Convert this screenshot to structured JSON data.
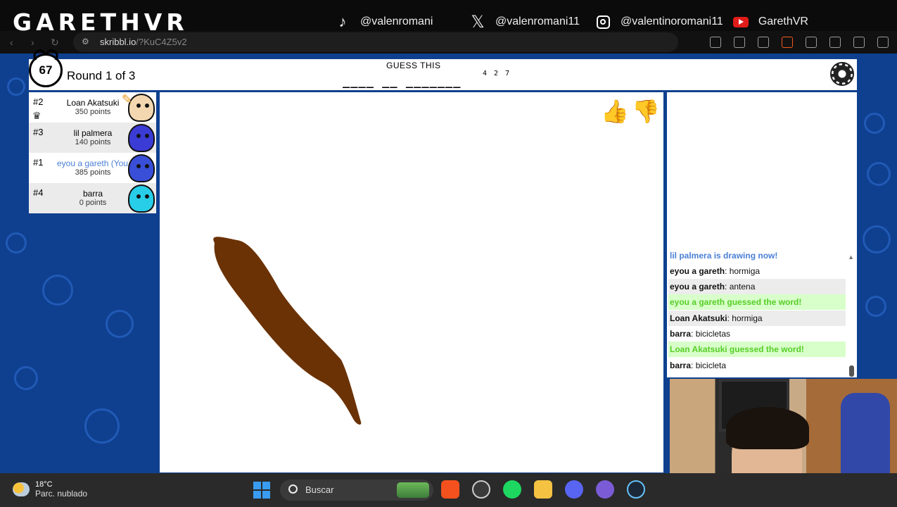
{
  "overlay": {
    "brand": "GARETHVR",
    "socials": [
      {
        "icon": "tiktok-icon",
        "handle": "@valenromani"
      },
      {
        "icon": "x-icon",
        "handle": "@valenromani11"
      },
      {
        "icon": "instagram-icon",
        "handle": "@valentinoromani11"
      },
      {
        "icon": "youtube-icon",
        "handle": "GarethVR"
      }
    ]
  },
  "browser": {
    "url_host": "skribbl.io",
    "url_path": "/?KuC4Z5v2"
  },
  "game": {
    "timer": "67",
    "round_text": "Round 1 of 3",
    "guess_label": "GUESS THIS",
    "hint": "____ __ _______",
    "hint_lengths": "4 2 7"
  },
  "players": [
    {
      "rank": "#2",
      "name": "Loan Akatsuki",
      "points": "350 points",
      "avatar_color": "#f3d7b1",
      "drawing": true
    },
    {
      "rank": "#3",
      "name": "lil palmera",
      "points": "140 points",
      "avatar_color": "#3b3bd6"
    },
    {
      "rank": "#1",
      "name": "eyou a gareth (You)",
      "points": "385 points",
      "avatar_color": "#3a4fd8",
      "you": true
    },
    {
      "rank": "#4",
      "name": "barra",
      "points": "0 points",
      "avatar_color": "#28cde8"
    }
  ],
  "chat": [
    {
      "type": "sys",
      "text": "lil palmera is drawing now!"
    },
    {
      "type": "msg",
      "user": "eyou a gareth",
      "text": "hormiga"
    },
    {
      "type": "msg",
      "user": "eyou a gareth",
      "text": "antena"
    },
    {
      "type": "ok",
      "text": "eyou a gareth guessed the word!"
    },
    {
      "type": "msg",
      "user": "Loan Akatsuki",
      "text": "hormiga"
    },
    {
      "type": "msg",
      "user": "barra",
      "text": "bicicletas"
    },
    {
      "type": "ok",
      "text": "Loan Akatsuki guessed the word!"
    },
    {
      "type": "msg",
      "user": "barra",
      "text": "bicicleta"
    }
  ],
  "taskbar": {
    "temp": "18°C",
    "weather": "Parc. nublado",
    "search_placeholder": "Buscar"
  },
  "colors": {
    "accent_you": "#4a7fd6",
    "guess_ok": "#56ce27",
    "drawing_brown": "#6b3206",
    "background": "#0f3f8f"
  }
}
